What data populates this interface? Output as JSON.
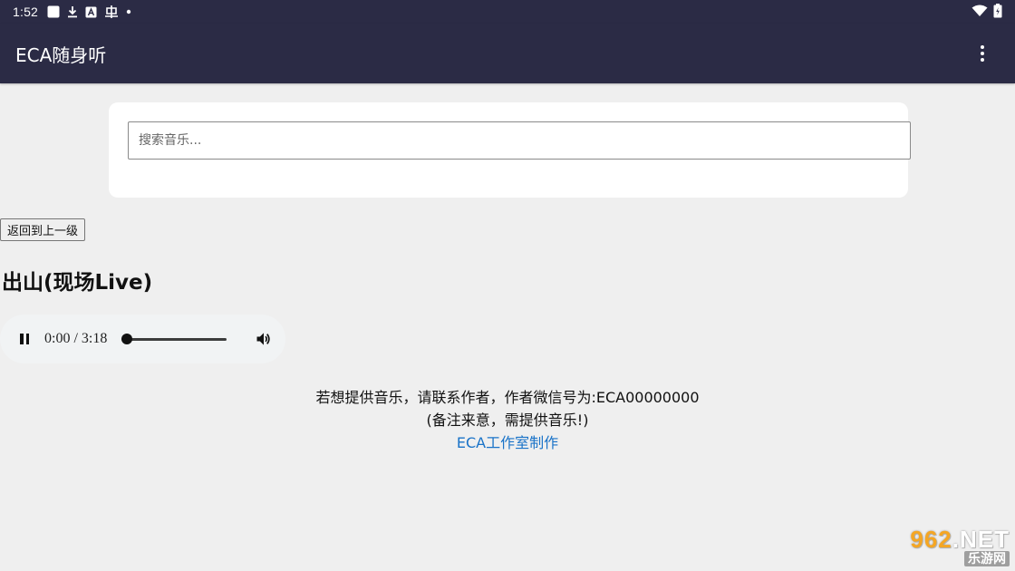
{
  "statusbar": {
    "time": "1:52",
    "icons": [
      "app-square-icon",
      "download-icon",
      "font-a-icon",
      "bug-icon",
      "dot-icon"
    ],
    "right_icons": [
      "wifi-icon",
      "battery-icon"
    ]
  },
  "appbar": {
    "title": "ECA随身听",
    "menu_icon": "more-vert-icon"
  },
  "search": {
    "placeholder": "搜索音乐...",
    "value": ""
  },
  "back_button": "返回到上一级",
  "song": {
    "title": "出山(现场Live)"
  },
  "player": {
    "time_display": "0:00 / 3:18",
    "progress": 0,
    "state": "playing"
  },
  "footer": {
    "line1": "若想提供音乐，请联系作者，作者微信号为:ECA00000000",
    "line2": "(备注来意，需提供音乐!)",
    "link": "ECA工作室制作"
  },
  "watermark": {
    "top_num": "962",
    "top_suffix": ".NET",
    "bottom": "乐游网"
  },
  "colors": {
    "appbar": "#2b2b45",
    "background": "#efefef",
    "link": "#1a73c8"
  }
}
